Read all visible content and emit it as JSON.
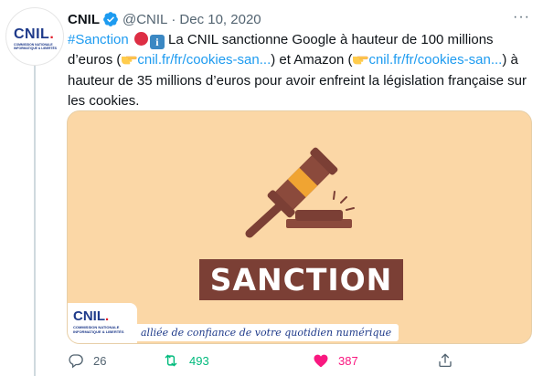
{
  "author": {
    "name": "CNIL",
    "handle": "@CNIL",
    "separator": "·",
    "date": "Dec 10, 2020",
    "avatar_logo": "CNIL",
    "avatar_logo_dot": ".",
    "avatar_subtitle": "COMMISSION NATIONALE INFORMATIQUE & LIBERTÉS"
  },
  "tweet": {
    "hashtag": "#Sanction",
    "info_glyph": "i",
    "text_part1": " La CNIL sanctionne Google à hauteur de 100 millions d’euros (",
    "link1": "cnil.fr/fr/cookies-san...",
    "text_part2": ") et Amazon (",
    "link2": "cnil.fr/fr/cookies-san...",
    "text_part3": ") à hauteur de 35 millions d’euros pour avoir enfreint la législation française sur les cookies."
  },
  "media": {
    "banner_text": "SANCTION",
    "badge_logo": "CNIL",
    "badge_logo_dot": ".",
    "badge_subtitle": "COMMISSION NATIONALE INFORMATIQUE & LIBERTÉS",
    "tagline": "alliée de confiance de votre quotidien numérique",
    "colors": {
      "background": "#fbd7a6",
      "banner": "#7b3f35",
      "gavel_body": "#8b4a3c",
      "gavel_band": "#f0a432"
    }
  },
  "actions": {
    "reply_count": "26",
    "retweet_count": "493",
    "like_count": "387",
    "icons": [
      "reply-icon",
      "retweet-icon",
      "like-icon",
      "share-icon"
    ],
    "colors": {
      "retweet": "#00ba7c",
      "like": "#f91880",
      "link": "#1d9bf0"
    }
  },
  "more_glyph": "···"
}
